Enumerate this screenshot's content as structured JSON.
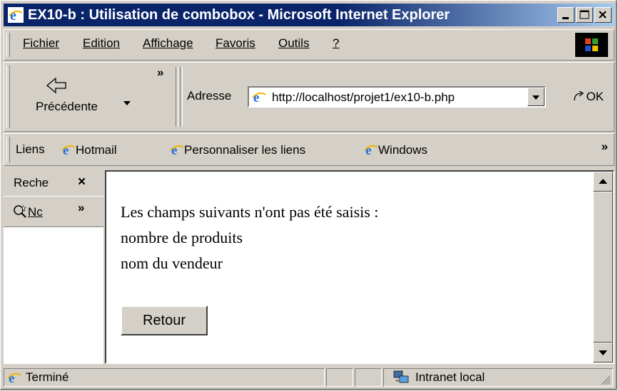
{
  "window": {
    "title": "EX10-b : Utilisation de combobox - Microsoft Internet Explorer"
  },
  "menu": {
    "items": [
      {
        "label": "Fichier"
      },
      {
        "label": "Edition"
      },
      {
        "label": "Affichage"
      },
      {
        "label": "Favoris"
      },
      {
        "label": "Outils"
      },
      {
        "label": "?"
      }
    ]
  },
  "toolbar": {
    "back_label": "Précédente",
    "chevron": "»",
    "address_label": "Adresse",
    "address_value": "http://localhost/projet1/ex10-b.php",
    "go_label": "OK"
  },
  "links": {
    "label": "Liens",
    "items": [
      {
        "label": "Hotmail",
        "icon": "ie-icon"
      },
      {
        "label": "Personnaliser les liens",
        "icon": "ie-icon"
      },
      {
        "label": "Windows",
        "icon": "ie-icon"
      }
    ],
    "chevron": "»"
  },
  "explorer": {
    "tab_label": "Reche",
    "close_glyph": "×",
    "search_label": "Nc",
    "chevron": "»"
  },
  "content": {
    "lines": [
      "Les champs suivants n'ont pas été saisis :",
      "nombre de produits",
      "nom du vendeur"
    ],
    "button_label": "Retour"
  },
  "status": {
    "text": "Terminé",
    "zone": "Intranet local"
  },
  "colors": {
    "title_start": "#0a246a",
    "title_end": "#a6caf0",
    "face": "#d4d0c8"
  }
}
